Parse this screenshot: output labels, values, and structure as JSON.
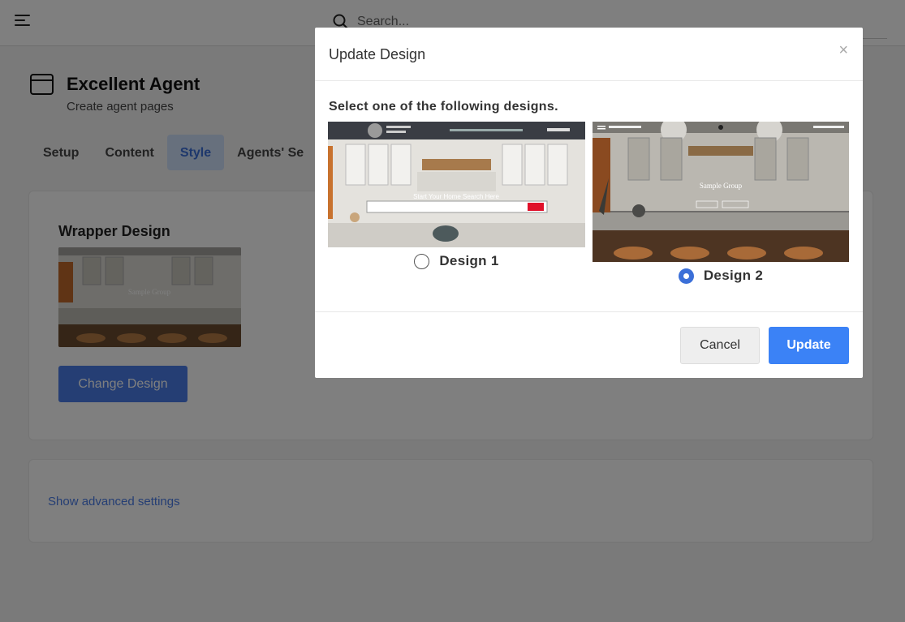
{
  "header": {
    "search_placeholder": "Search..."
  },
  "page": {
    "title": "Excellent Agent",
    "subtitle": "Create agent pages"
  },
  "tabs": [
    {
      "label": "Setup",
      "active": false
    },
    {
      "label": "Content",
      "active": false
    },
    {
      "label": "Style",
      "active": true
    },
    {
      "label": "Agents' Se",
      "active": false
    }
  ],
  "wrapper": {
    "title": "Wrapper Design",
    "change_button": "Change Design"
  },
  "advanced": {
    "link": "Show advanced settings"
  },
  "modal": {
    "title": "Update Design",
    "close_label": "×",
    "instruction": "Select one of the following designs.",
    "designs": [
      {
        "label": "Design 1",
        "selected": false,
        "banner_text": "Start Your Home Search Here"
      },
      {
        "label": "Design 2",
        "selected": true,
        "banner_text": "Sample Group"
      }
    ],
    "cancel_label": "Cancel",
    "update_label": "Update"
  },
  "colors": {
    "accent": "#3b82f6",
    "tab_active_bg": "#cfe0fb",
    "button_blue": "#4a7de8"
  }
}
